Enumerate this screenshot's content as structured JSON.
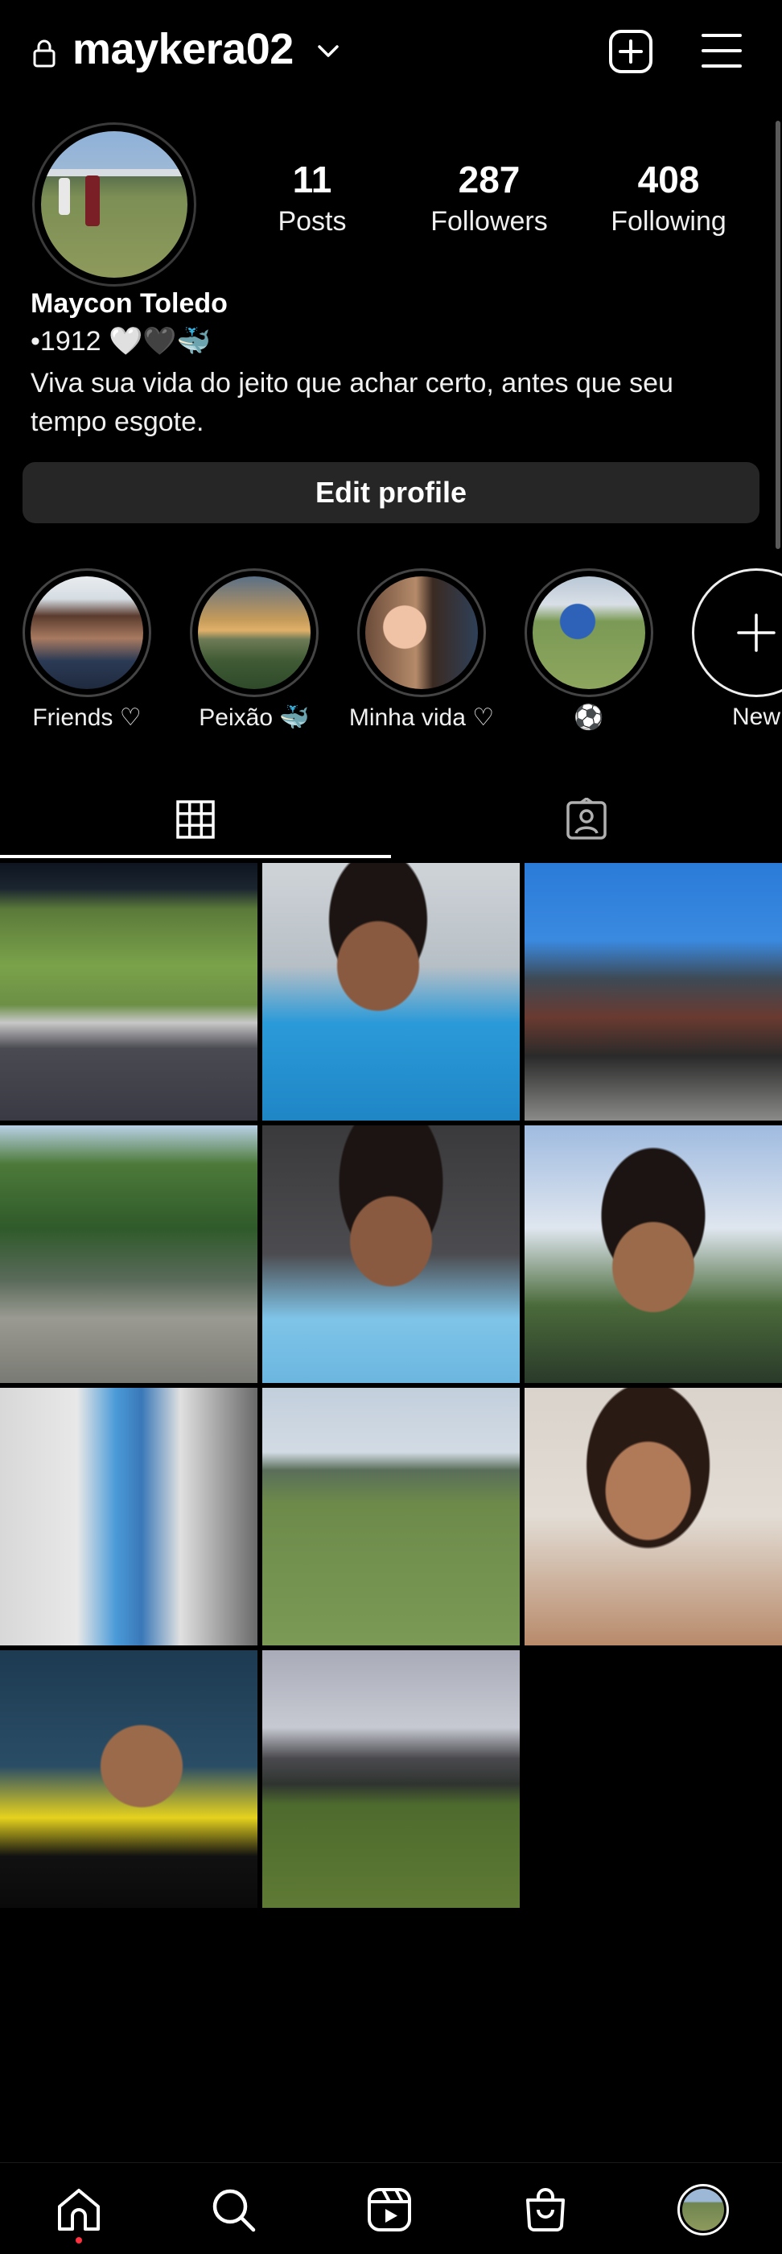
{
  "header": {
    "username": "maykera02",
    "icons": {
      "lock": "lock-icon",
      "dropdown": "chevron-down-icon",
      "create": "plus-square-icon",
      "menu": "hamburger-menu-icon"
    }
  },
  "profile": {
    "posts_count": "11",
    "posts_label": "Posts",
    "followers_count": "287",
    "followers_label": "Followers",
    "following_count": "408",
    "following_label": "Following",
    "full_name": "Maycon Toledo",
    "bio_line1": "•1912 🤍🖤🐳",
    "bio_line2": "Viva sua vida do jeito que achar certo, antes que seu tempo esgote.",
    "edit_button": "Edit profile"
  },
  "highlights": [
    {
      "label": "Friends ♡"
    },
    {
      "label": "Peixão 🐳"
    },
    {
      "label": "Minha vida ♡"
    },
    {
      "label": "⚽"
    },
    {
      "label": "New"
    }
  ],
  "tabs": {
    "grid": "grid-icon",
    "tagged": "tagged-person-icon",
    "selected": "grid"
  },
  "posts_grid": {
    "count": 11
  },
  "bottom_nav": {
    "items": [
      "home-icon",
      "search-icon",
      "reels-icon",
      "shop-icon",
      "profile-avatar"
    ],
    "active": "home",
    "notification_dot_color": "#ff3040"
  },
  "colors": {
    "background": "#000000",
    "button": "#262626",
    "text": "#f5f5f5"
  }
}
